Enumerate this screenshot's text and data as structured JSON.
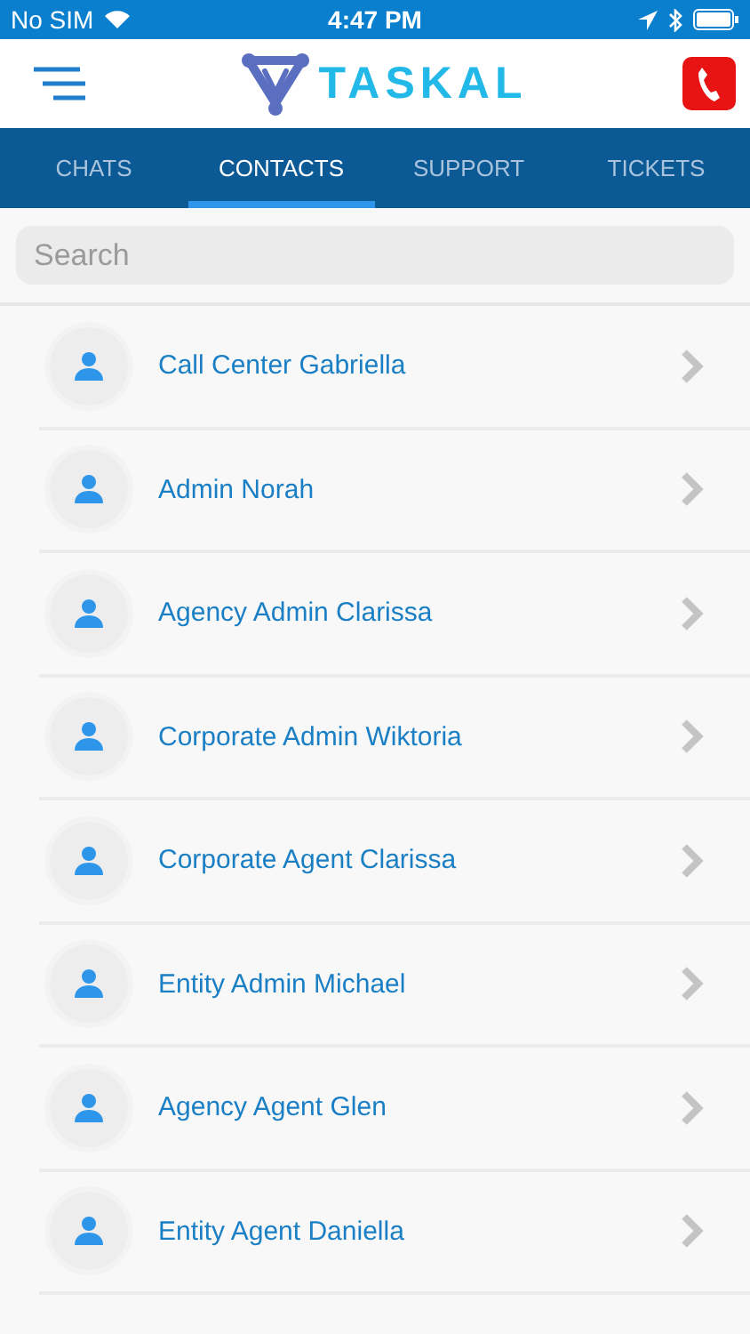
{
  "status_bar": {
    "carrier": "No SIM",
    "time": "4:47 PM"
  },
  "header": {
    "logo_text": "TASKAL"
  },
  "tabs": [
    {
      "label": "CHATS",
      "selected": false
    },
    {
      "label": "CONTACTS",
      "selected": true
    },
    {
      "label": "SUPPORT",
      "selected": false
    },
    {
      "label": "TICKETS",
      "selected": false
    }
  ],
  "search": {
    "placeholder": "Search"
  },
  "contacts": [
    {
      "name": "Call Center Gabriella"
    },
    {
      "name": "Admin Norah"
    },
    {
      "name": "Agency Admin Clarissa"
    },
    {
      "name": "Corporate Admin Wiktoria"
    },
    {
      "name": "Corporate Agent Clarissa"
    },
    {
      "name": "Entity Admin Michael"
    },
    {
      "name": "Agency Agent Glen"
    },
    {
      "name": "Entity Agent Daniella"
    }
  ]
}
